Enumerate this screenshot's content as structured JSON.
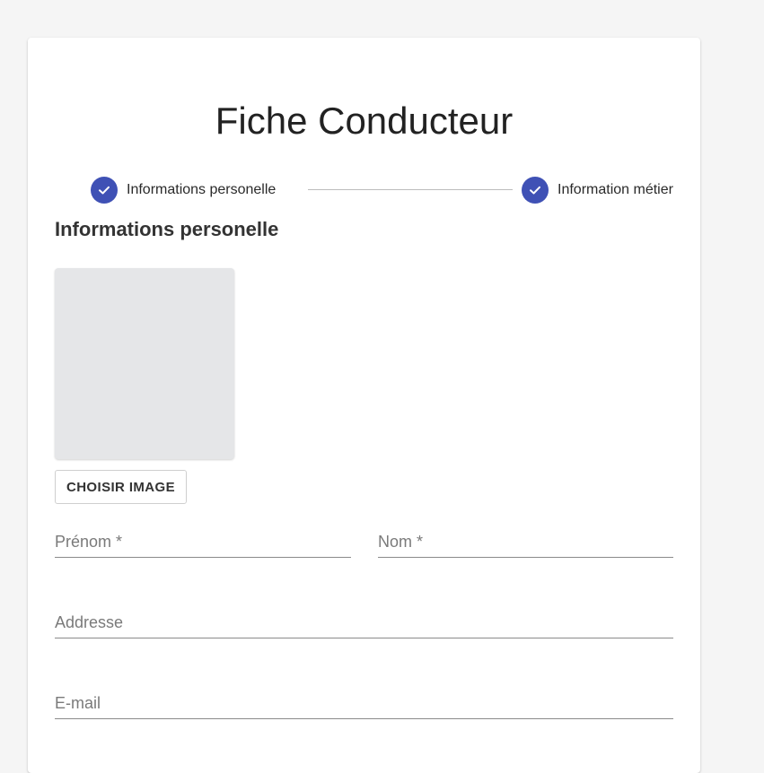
{
  "page": {
    "title": "Fiche Conducteur"
  },
  "stepper": {
    "accent_color": "#3f51b5",
    "steps": [
      {
        "label": "Informations personelle",
        "icon": "check-circle-icon",
        "completed": true
      },
      {
        "label": "Information métier",
        "icon": "check-circle-icon",
        "completed": true
      }
    ]
  },
  "section": {
    "title": "Informations personelle"
  },
  "photo": {
    "button_label": "CHOISIR IMAGE"
  },
  "form": {
    "prenom": {
      "placeholder": "Prénom *",
      "value": ""
    },
    "nom": {
      "placeholder": "Nom *",
      "value": ""
    },
    "address": {
      "placeholder": "Addresse",
      "value": ""
    },
    "email": {
      "placeholder": "E-mail",
      "value": ""
    }
  }
}
